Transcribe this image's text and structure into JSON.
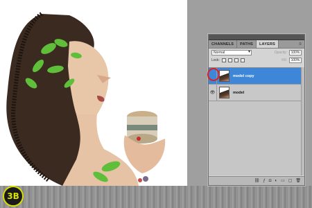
{
  "panel": {
    "tabs": [
      "CHANNELS",
      "PATHS",
      "LAYERS"
    ],
    "blend_mode": "Normal",
    "opacity_label": "Opacity:",
    "opacity_value": "100%",
    "lock_label": "Lock:",
    "fill_label": "Fill:",
    "fill_value": "100%",
    "layers": [
      {
        "name": "model copy",
        "visible": false,
        "selected": true
      },
      {
        "name": "model",
        "visible": true,
        "selected": false
      }
    ]
  },
  "logo": {
    "text": "3B"
  },
  "colors": {
    "selection": "#3d86d8",
    "highlight_circle": "#e02020",
    "logo_accent": "#d8e000"
  },
  "icons": [
    "panel-menu-icon",
    "lock-transparent-icon",
    "lock-image-icon",
    "lock-position-icon",
    "lock-all-icon",
    "eye-icon",
    "link-layers-icon",
    "fx-icon",
    "mask-icon",
    "adjustment-icon",
    "group-icon",
    "new-layer-icon",
    "trash-icon"
  ]
}
